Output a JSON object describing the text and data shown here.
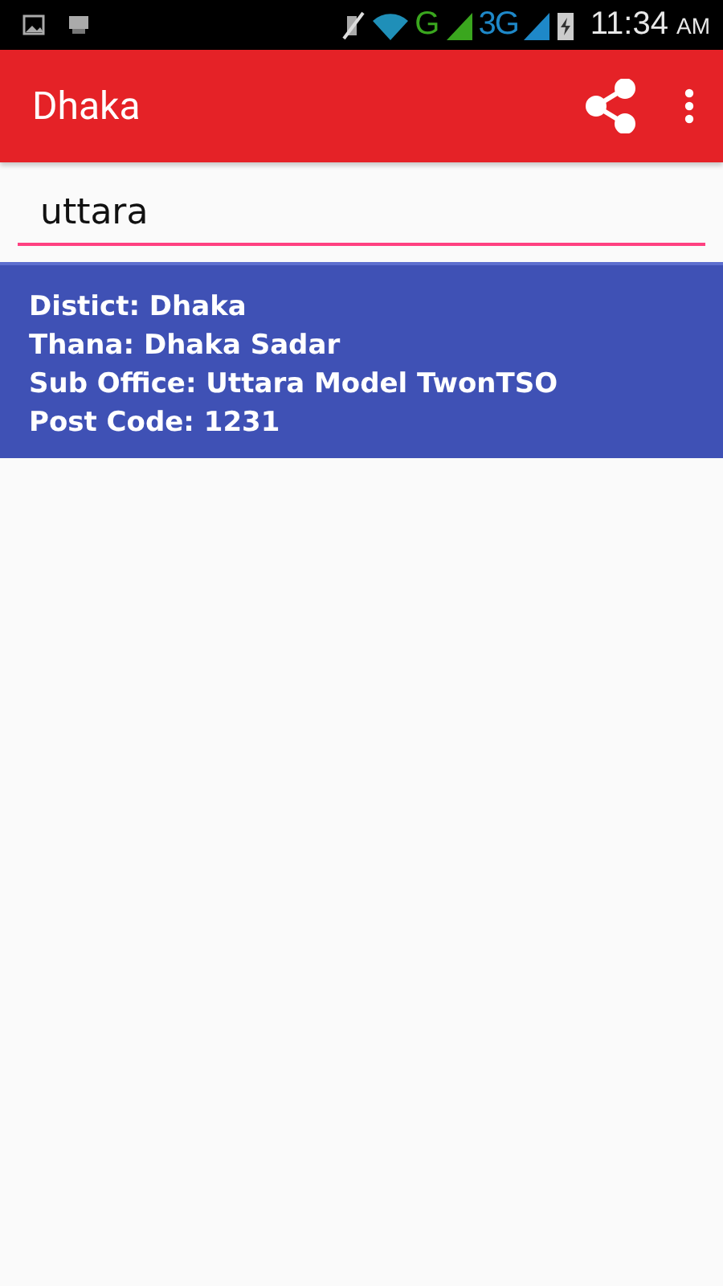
{
  "status_bar": {
    "network_1": "G",
    "network_2": "3G",
    "time": "11:34",
    "meridiem": "AM"
  },
  "app_bar": {
    "title": "Dhaka"
  },
  "search": {
    "value": "uttara"
  },
  "results": [
    {
      "lines": [
        "Distict: Dhaka",
        "Thana: Dhaka Sadar",
        "Sub Office: Uttara Model TwonTSO",
        "Post Code: 1231"
      ]
    }
  ]
}
